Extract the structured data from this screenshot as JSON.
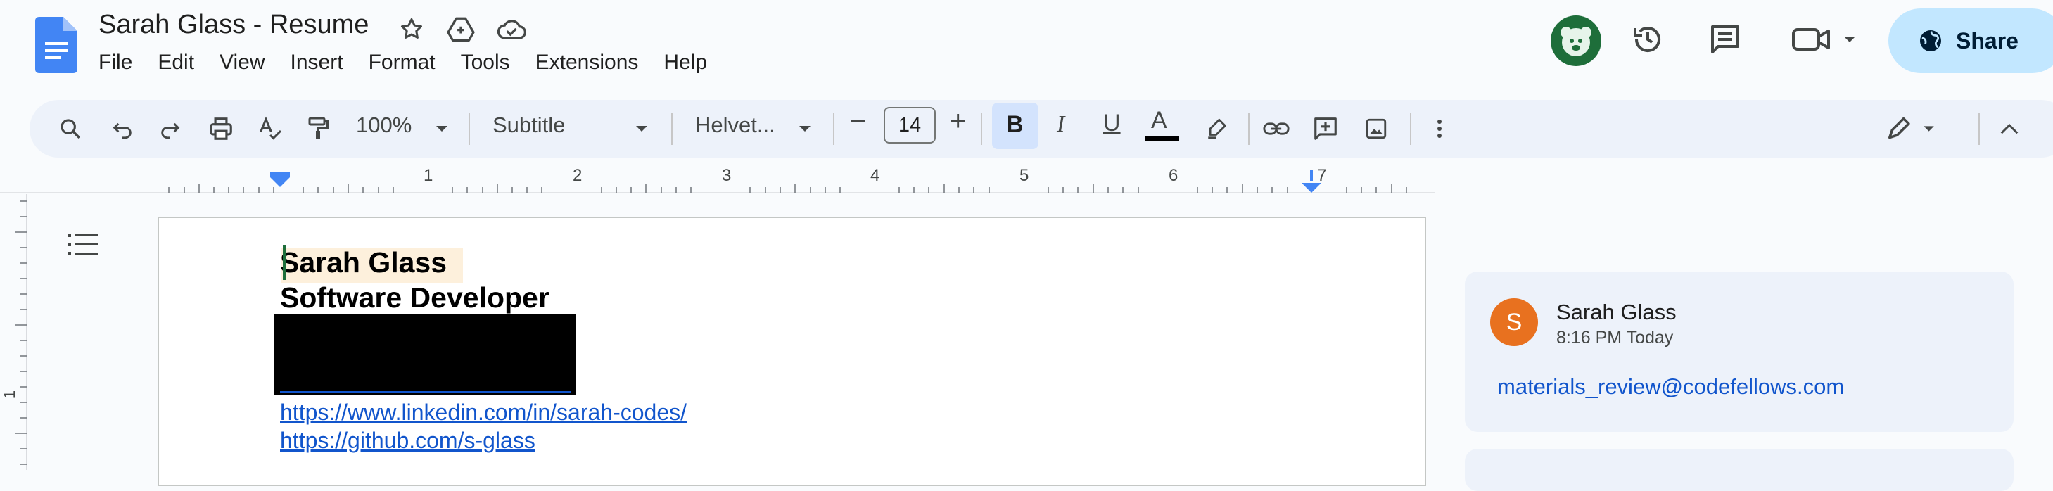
{
  "header": {
    "title": "Sarah Glass - Resume",
    "menu": [
      "File",
      "Edit",
      "View",
      "Insert",
      "Format",
      "Tools",
      "Extensions",
      "Help"
    ],
    "share_label": "Share"
  },
  "toolbar": {
    "zoom": "100%",
    "style": "Subtitle",
    "font": "Helvet...",
    "font_size": "14",
    "bold_label": "B",
    "italic_label": "I",
    "underline_label": "U",
    "text_color_label": "A",
    "decrease_label": "−",
    "increase_label": "+"
  },
  "ruler": {
    "numbers": [
      "1",
      "2",
      "3",
      "4",
      "5",
      "6",
      "7"
    ]
  },
  "side_ruler": {
    "numbers": [
      "1"
    ]
  },
  "document": {
    "name": "Sarah Glass",
    "role": "Software Developer",
    "linkedin": "https://www.linkedin.com/in/sarah-codes/",
    "github": "https://github.com/s-glass"
  },
  "comment": {
    "avatar_letter": "S",
    "author": "Sarah Glass",
    "time": "8:16 PM Today",
    "body": "materials_review@codefellows.com"
  },
  "icons": {
    "docs_logo": "docs-logo",
    "star": "star-icon",
    "move_to_drive": "drive-icon",
    "cloud_status": "cloud-icon",
    "history": "history-icon",
    "comments": "comment-icon",
    "meet": "video-icon",
    "globe": "globe-icon"
  },
  "colors": {
    "accent": "#c2e7ff",
    "link": "#1155cc",
    "avatar_comment": "#e8711f",
    "avatar_top": "#1e6e3a",
    "highlight": "#fdf0dc"
  }
}
